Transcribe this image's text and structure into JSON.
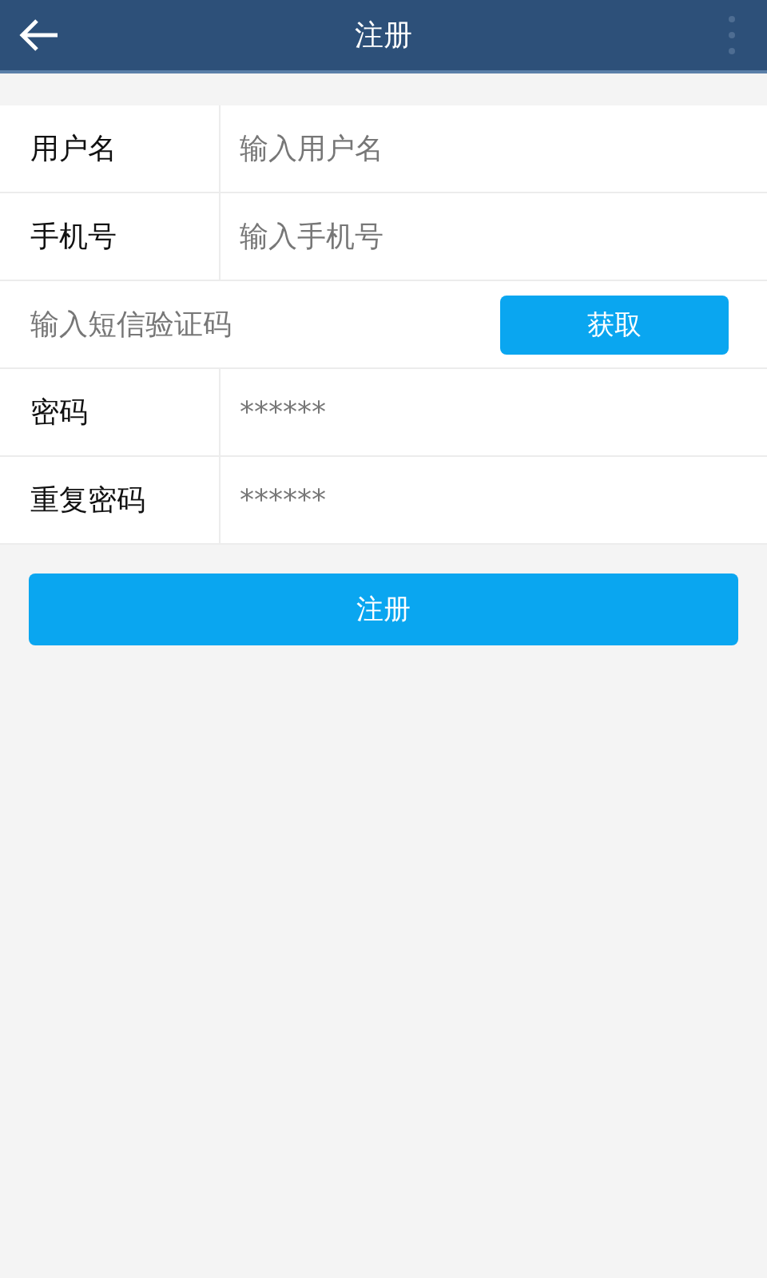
{
  "toolbar": {
    "title": "注册"
  },
  "fields": [
    {
      "kind": "labeled",
      "label": "用户名",
      "placeholder": "输入用户名"
    },
    {
      "kind": "labeled",
      "label": "手机号",
      "placeholder": "输入手机号"
    },
    {
      "kind": "code",
      "placeholder": "输入短信验证码",
      "button": "获取"
    },
    {
      "kind": "labeled",
      "label": "密码",
      "placeholder": "******"
    },
    {
      "kind": "labeled",
      "label": "重复密码",
      "placeholder": "******"
    }
  ],
  "submit": "注册"
}
